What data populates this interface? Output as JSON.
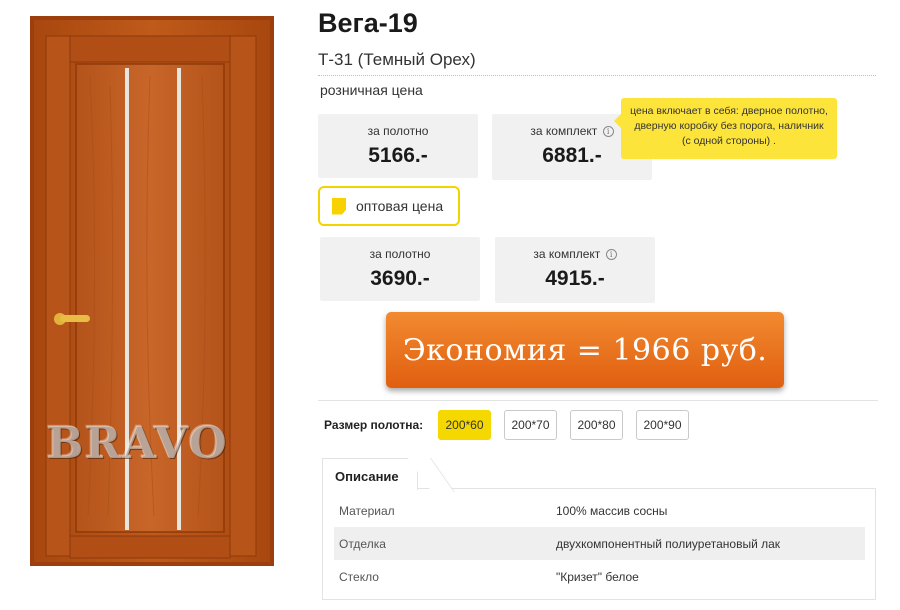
{
  "product": {
    "title": "Вега-19",
    "subtitle": "Т-31 (Темный Орех)",
    "image_watermark": "BRAVO"
  },
  "retail": {
    "label": "розничная цена",
    "blade_label": "за полотно",
    "blade_price": "5166.-",
    "kit_label": "за комплект",
    "kit_price": "6881.-",
    "tooltip": "цена включает в себя: дверное полотно, дверную коробку без порога, наличник (с одной стороны) ."
  },
  "wholesale": {
    "button_label": "оптовая цена",
    "blade_label": "за полотно",
    "blade_price": "3690.-",
    "kit_label": "за комплект",
    "kit_price": "4915.-"
  },
  "savings": {
    "text": "Экономия = 1966 руб."
  },
  "sizes": {
    "label": "Размер полотна:",
    "options": [
      "200*60",
      "200*70",
      "200*80",
      "200*90"
    ],
    "selected": "200*60"
  },
  "description": {
    "tab_label": "Описание",
    "rows": [
      {
        "key": "Материал",
        "value": "100% массив сосны"
      },
      {
        "key": "Отделка",
        "value": "двухкомпонентный полиуретановый лак"
      },
      {
        "key": "Стекло",
        "value": "\"Кризет\" белое"
      }
    ]
  },
  "icons": {
    "info": "info-icon",
    "wholesale": "note-icon"
  },
  "colors": {
    "accent_yellow": "#f5d800",
    "banner_orange": "#e8731c",
    "door_wood": "#b24f13"
  }
}
